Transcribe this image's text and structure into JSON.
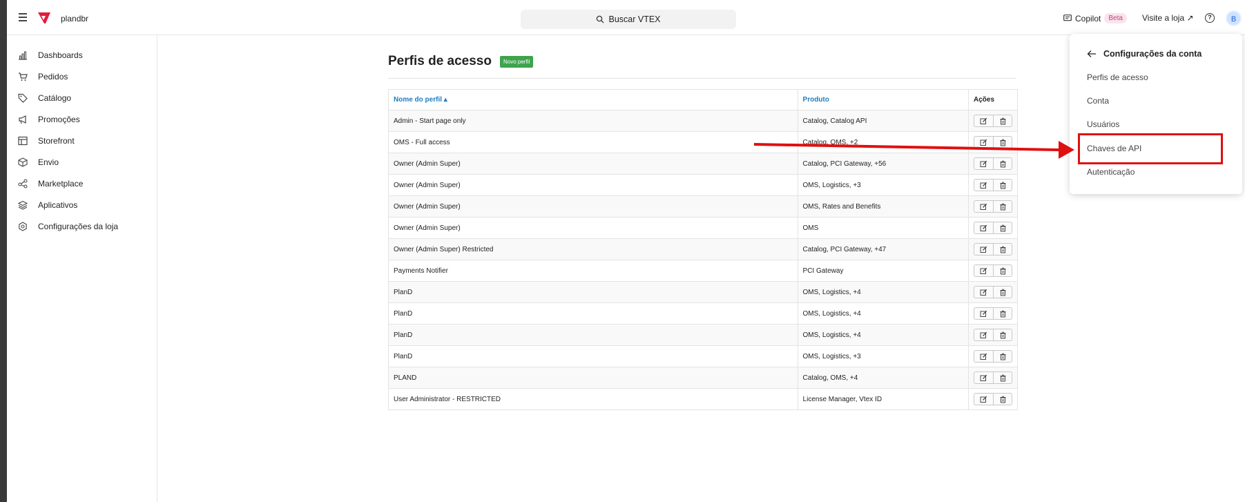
{
  "topbar": {
    "store_name": "plandbr",
    "search_label": "Buscar VTEX",
    "copilot_label": "Copilot",
    "copilot_badge": "Beta",
    "visit_store": "Visite a loja ↗",
    "help": "?",
    "avatar_initial": "B"
  },
  "sidebar": {
    "items": [
      {
        "label": "Dashboards",
        "icon": "chart-bars-icon"
      },
      {
        "label": "Pedidos",
        "icon": "cart-icon"
      },
      {
        "label": "Catálogo",
        "icon": "tag-icon"
      },
      {
        "label": "Promoções",
        "icon": "megaphone-icon"
      },
      {
        "label": "Storefront",
        "icon": "layout-icon"
      },
      {
        "label": "Envio",
        "icon": "box-icon"
      },
      {
        "label": "Marketplace",
        "icon": "share-icon"
      },
      {
        "label": "Aplicativos",
        "icon": "layers-icon"
      },
      {
        "label": "Configurações da loja",
        "icon": "settings-icon"
      }
    ]
  },
  "main": {
    "title": "Perfis de acesso",
    "new_profile_button": "Novo perfil",
    "table": {
      "headers": {
        "name": "Nome do perfil ▴",
        "product": "Produto",
        "actions": "Ações"
      },
      "rows": [
        {
          "name": "Admin - Start page only",
          "product": "Catalog, Catalog API"
        },
        {
          "name": "OMS - Full access",
          "product": "Catalog, OMS, +2"
        },
        {
          "name": "Owner (Admin Super)",
          "product": "Catalog, PCI Gateway, +56"
        },
        {
          "name": "Owner (Admin Super)",
          "product": "OMS, Logistics, +3"
        },
        {
          "name": "Owner (Admin Super)",
          "product": "OMS, Rates and Benefits"
        },
        {
          "name": "Owner (Admin Super)",
          "product": "OMS"
        },
        {
          "name": "Owner (Admin Super) Restricted",
          "product": "Catalog, PCI Gateway, +47"
        },
        {
          "name": "Payments Notifier",
          "product": "PCI Gateway"
        },
        {
          "name": "PlanD",
          "product": "OMS, Logistics, +4"
        },
        {
          "name": "PlanD",
          "product": "OMS, Logistics, +4"
        },
        {
          "name": "PlanD",
          "product": "OMS, Logistics, +4"
        },
        {
          "name": "PlanD",
          "product": "OMS, Logistics, +3"
        },
        {
          "name": "PLAND",
          "product": "Catalog, OMS, +4"
        },
        {
          "name": "User Administrator - RESTRICTED",
          "product": "License Manager, Vtex ID"
        }
      ]
    }
  },
  "account_panel": {
    "title": "Configurações da conta",
    "items": [
      "Perfis de acesso",
      "Conta",
      "Usuários",
      "Chaves de API",
      "Autenticação"
    ],
    "highlighted_item": "Chaves de API"
  },
  "colors": {
    "link_blue": "#1e7dc0",
    "new_profile_green": "#3fa34d",
    "annotation_red": "#e01010",
    "logo_red": "#e31c3d"
  }
}
